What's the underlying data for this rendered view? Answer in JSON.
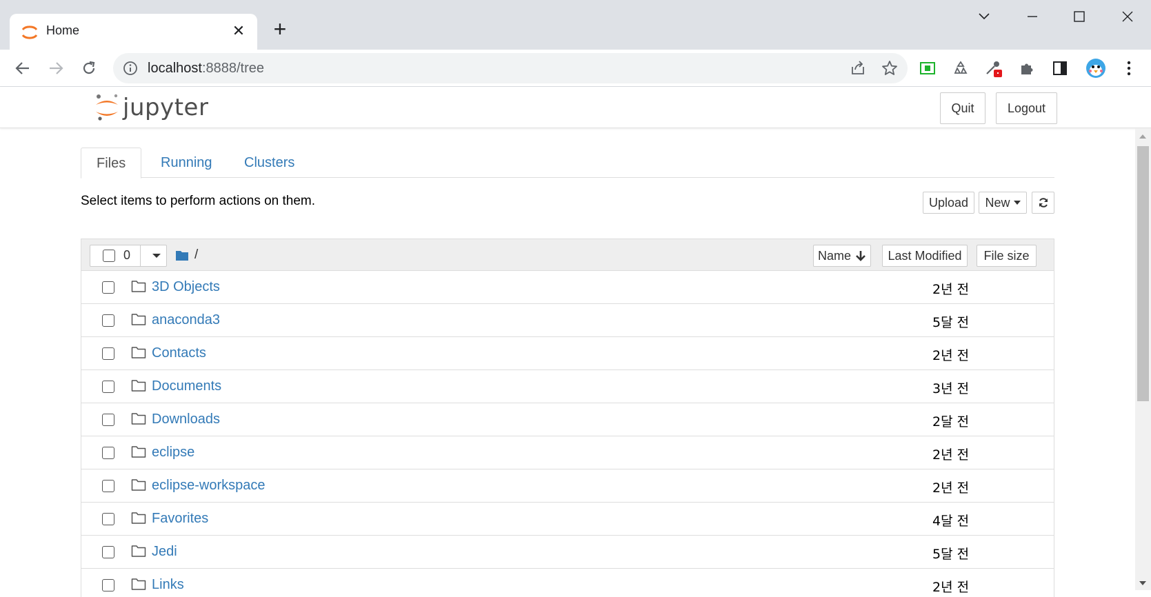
{
  "browser": {
    "tab_title": "Home",
    "url_host": "localhost",
    "url_path": ":8888/tree"
  },
  "header": {
    "logo_text": "jupyter",
    "quit_label": "Quit",
    "logout_label": "Logout"
  },
  "tabs": [
    {
      "label": "Files",
      "active": true
    },
    {
      "label": "Running",
      "active": false
    },
    {
      "label": "Clusters",
      "active": false
    }
  ],
  "toolbar": {
    "hint": "Select items to perform actions on them.",
    "upload_label": "Upload",
    "new_label": "New"
  },
  "list_header": {
    "selected_count": "0",
    "breadcrumb": "/",
    "sort_name_label": "Name",
    "sort_modified_label": "Last Modified",
    "sort_size_label": "File size"
  },
  "files": [
    {
      "name": "3D Objects",
      "modified": "2년 전"
    },
    {
      "name": "anaconda3",
      "modified": "5달 전"
    },
    {
      "name": "Contacts",
      "modified": "2년 전"
    },
    {
      "name": "Documents",
      "modified": "3년 전"
    },
    {
      "name": "Downloads",
      "modified": "2달 전"
    },
    {
      "name": "eclipse",
      "modified": "2년 전"
    },
    {
      "name": "eclipse-workspace",
      "modified": "2년 전"
    },
    {
      "name": "Favorites",
      "modified": "4달 전"
    },
    {
      "name": "Jedi",
      "modified": "5달 전"
    },
    {
      "name": "Links",
      "modified": "2년 전"
    }
  ],
  "colors": {
    "link": "#337ab7",
    "jupyter_orange": "#f37726",
    "chrome_frame": "#dee1e6"
  }
}
